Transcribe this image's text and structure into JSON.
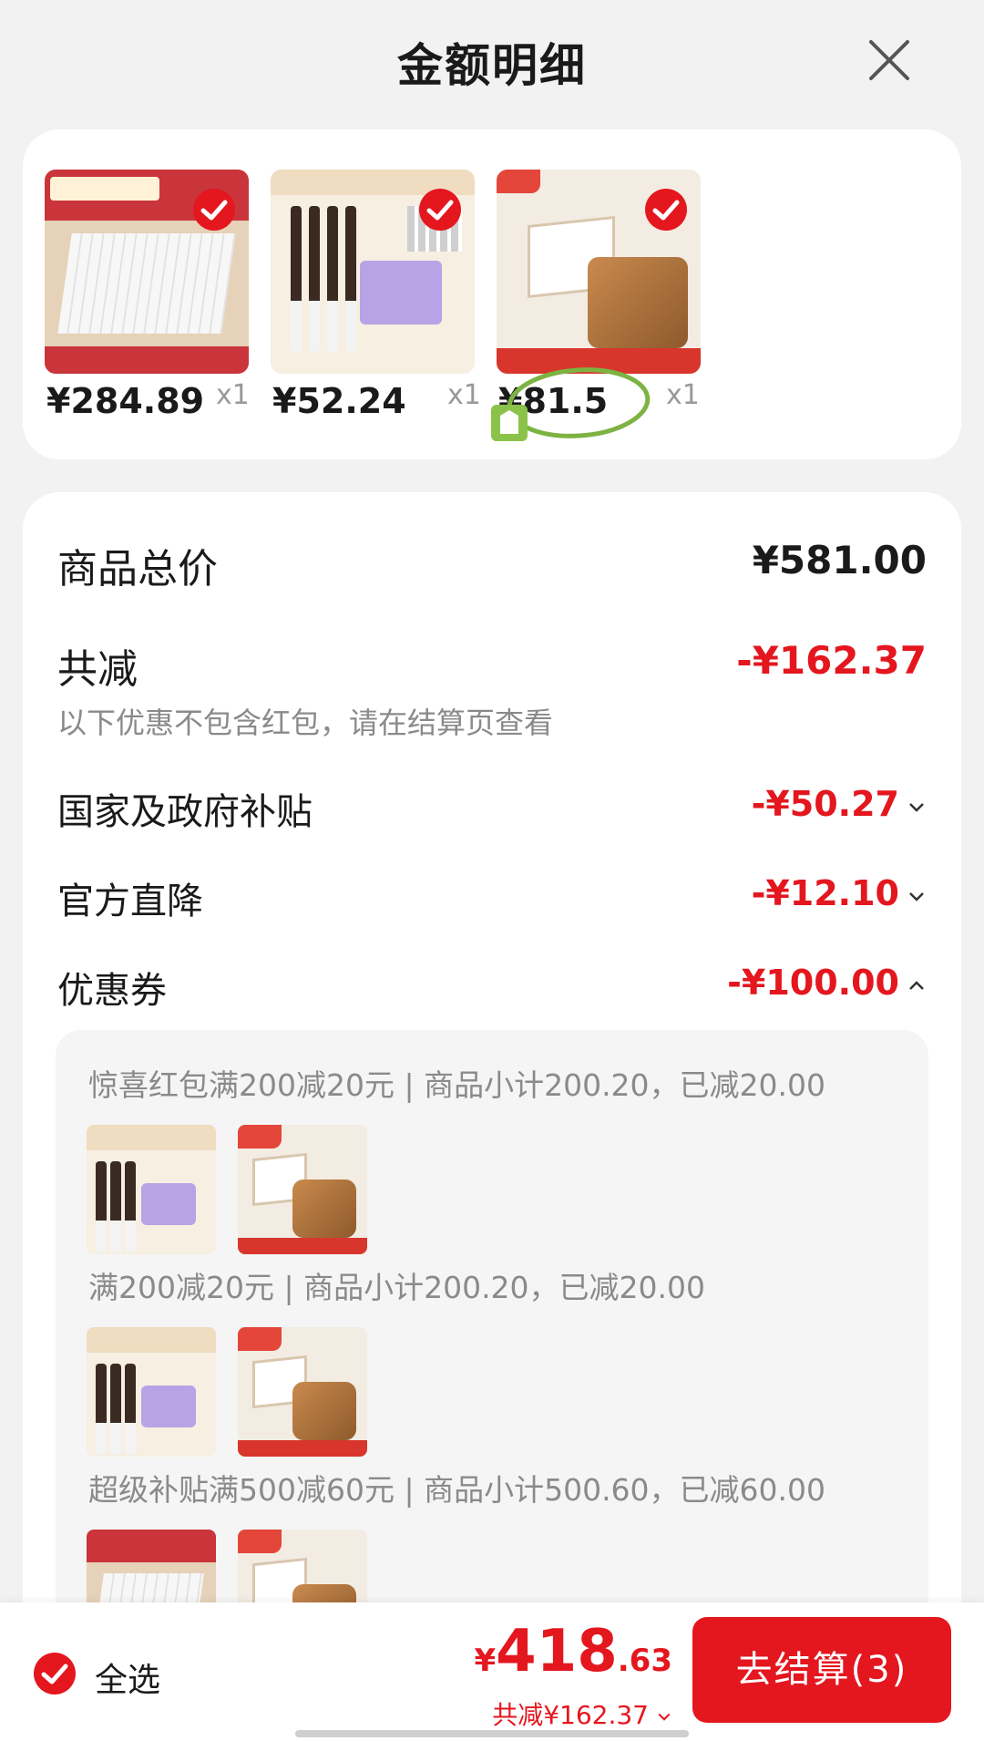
{
  "header": {
    "title": "金额明细"
  },
  "products": [
    {
      "thumb_kind": "bed-pad",
      "price": "¥284.89",
      "qty": "x1",
      "selected": true
    },
    {
      "thumb_kind": "brush-set",
      "price": "¥52.24",
      "qty": "x1",
      "selected": true
    },
    {
      "thumb_kind": "book-stand",
      "price": "¥81.5",
      "qty": "x1",
      "selected": true
    }
  ],
  "breakdown": {
    "total_label": "商品总价",
    "total_value": "¥581.00",
    "discount_label": "共减",
    "discount_value": "-¥162.37",
    "discount_note": "以下优惠不包含红包，请在结算页查看",
    "subsidy_label": "国家及政府补贴",
    "subsidy_value": "-¥50.27",
    "official_label": "官方直降",
    "official_value": "-¥12.10",
    "coupon_label": "优惠券",
    "coupon_value": "-¥100.00"
  },
  "coupons": [
    {
      "text": "惊喜红包满200减20元 | 商品小计200.20，已减20.00",
      "thumbs": [
        "brush-set",
        "book-stand"
      ]
    },
    {
      "text": "满200减20元 | 商品小计200.20，已减20.00",
      "thumbs": [
        "brush-set",
        "book-stand"
      ]
    },
    {
      "text": "超级补贴满500减60元 | 商品小计500.60，已减60.00",
      "thumbs": [
        "bed-pad",
        "book-stand"
      ]
    }
  ],
  "bottom_bar": {
    "select_all_label": "全选",
    "currency": "¥",
    "total_integer": "418",
    "total_decimal": ".63",
    "saved_text": "共减¥162.37",
    "checkout_label": "去结算(3)"
  },
  "colors": {
    "accent_red": "#e4161e",
    "check_red": "#e4161e",
    "circle_green": "#7cb342"
  }
}
